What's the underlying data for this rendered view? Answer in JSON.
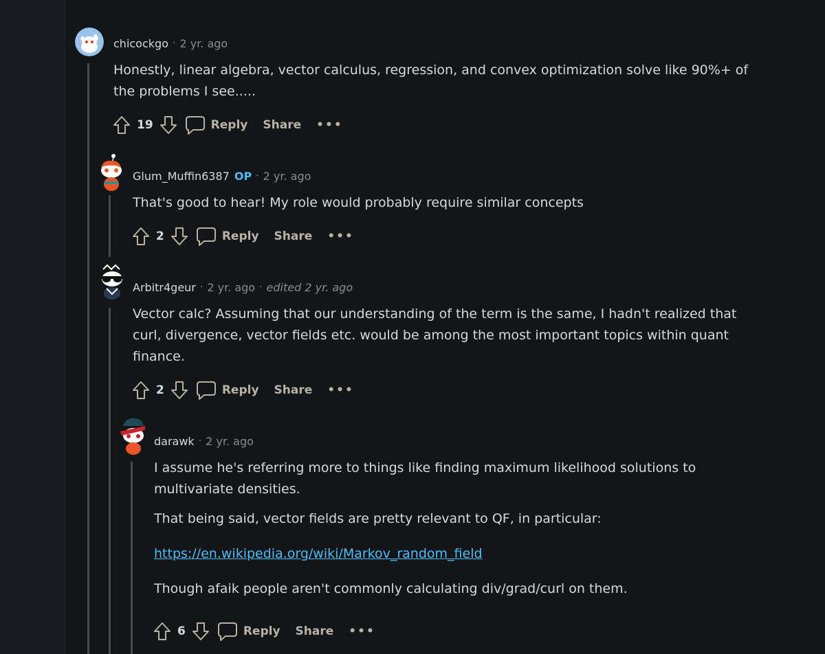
{
  "comments": [
    {
      "author": "chicockgo",
      "time": "2 yr. ago",
      "body": [
        "Honestly, linear algebra, vector calculus, regression, and convex optimization solve like 90%+ of the problems I see....."
      ],
      "score": "19",
      "reply": "Reply",
      "share": "Share",
      "more": "•••"
    },
    {
      "author": "Glum_Muffin6387",
      "badge": "OP",
      "time": "2 yr. ago",
      "body": [
        "That's good to hear! My role would probably require similar concepts"
      ],
      "score": "2",
      "reply": "Reply",
      "share": "Share",
      "more": "•••"
    },
    {
      "author": "Arbitr4geur",
      "time": "2 yr. ago",
      "edited": "edited 2 yr. ago",
      "body": [
        "Vector calc? Assuming that our understanding of the term is the same, I hadn't realized that curl, divergence, vector fields etc. would be among the most important topics within quant finance."
      ],
      "score": "2",
      "reply": "Reply",
      "share": "Share",
      "more": "•••"
    },
    {
      "author": "darawk",
      "time": "2 yr. ago",
      "body": [
        "I assume he's referring more to things like finding maximum likelihood solutions to multivariate densities.",
        "That being said, vector fields are pretty relevant to QF, in particular:",
        "https://en.wikipedia.org/wiki/Markov_random_field",
        "Though afaik people aren't commonly calculating div/grad/curl on them."
      ],
      "score": "6",
      "reply": "Reply",
      "share": "Share",
      "more": "•••"
    }
  ],
  "separator": "·",
  "colors": {
    "background": "#131516",
    "gutter": "#181c23",
    "text": "#d7dadc",
    "muted": "#8a8c8e",
    "action": "#b7b2a9",
    "link": "#4fbcff",
    "op_badge": "#4fbcff",
    "thread_line": "#4a4a4a"
  },
  "icons": [
    "upvote-icon",
    "downvote-icon",
    "comment-bubble-icon"
  ]
}
